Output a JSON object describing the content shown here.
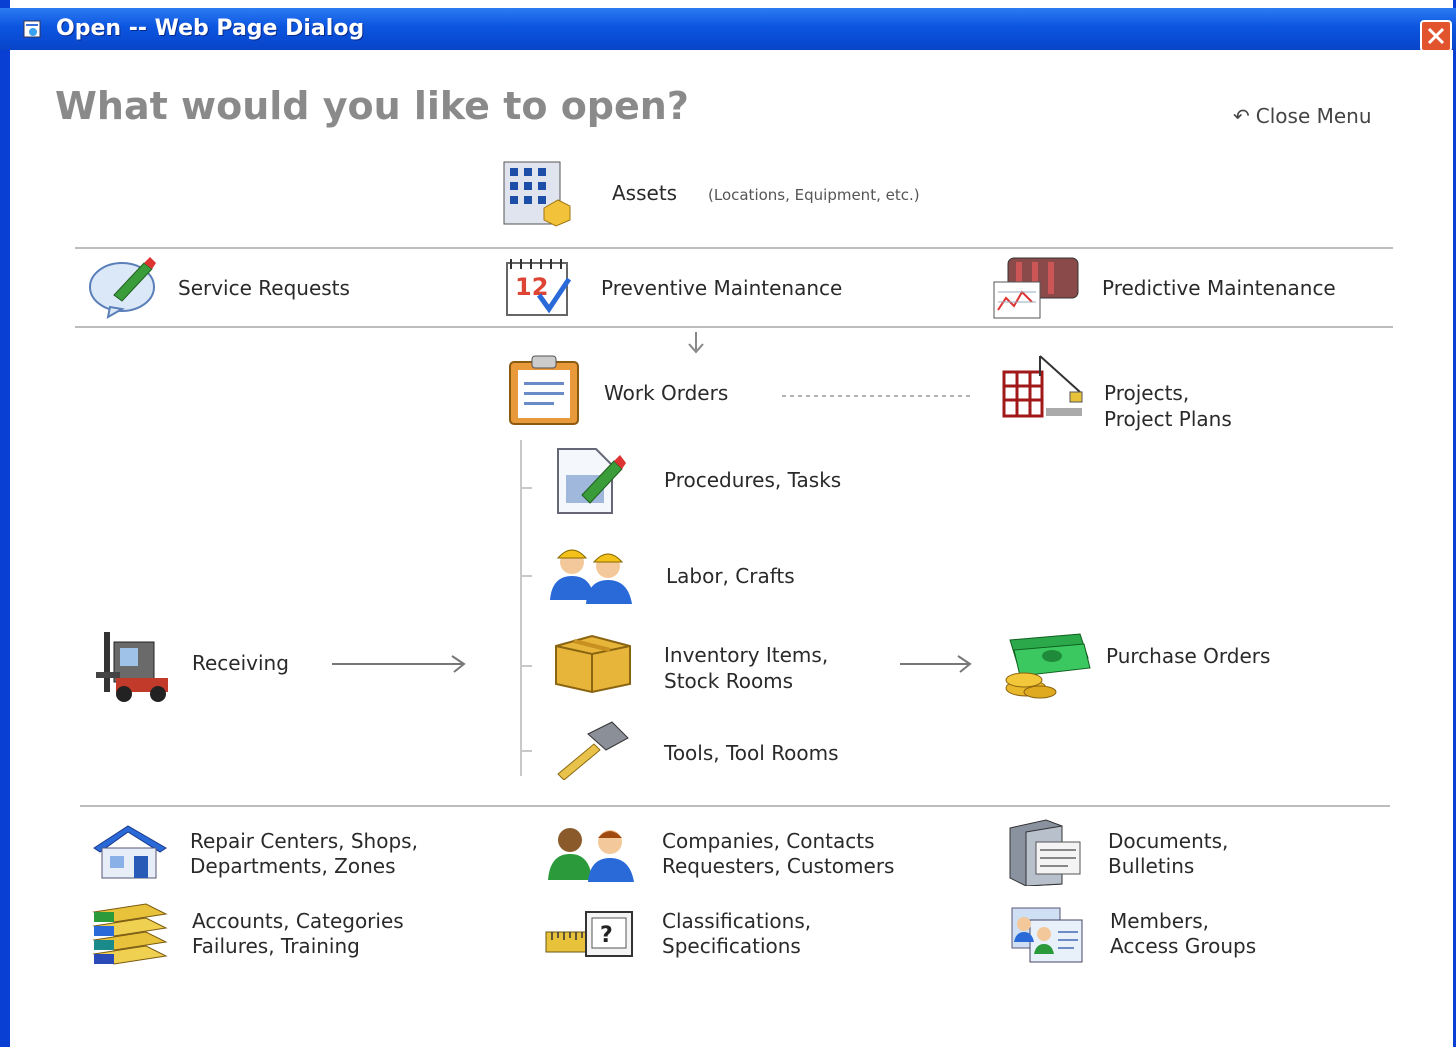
{
  "window": {
    "title": "Open -- Web Page Dialog"
  },
  "heading": "What would you like to open?",
  "close_menu": {
    "arrow": "↶",
    "label": "Close Menu"
  },
  "assets": {
    "label": "Assets",
    "sub": "(Locations, Equipment, etc.)"
  },
  "row1": {
    "service_requests": "Service Requests",
    "preventive_maintenance": "Preventive Maintenance",
    "predictive_maintenance": "Predictive Maintenance"
  },
  "work_orders": "Work Orders",
  "projects": {
    "line1": "Projects,",
    "line2": "Project Plans"
  },
  "procedures": "Procedures, Tasks",
  "labor": "Labor, Crafts",
  "receiving": "Receiving",
  "inventory": {
    "line1": "Inventory Items,",
    "line2": "Stock Rooms"
  },
  "purchase_orders": "Purchase Orders",
  "tools": "Tools, Tool Rooms",
  "bottom": {
    "repair": {
      "line1": "Repair Centers, Shops,",
      "line2": "Departments, Zones"
    },
    "companies": {
      "line1": "Companies, Contacts",
      "line2": "Requesters, Customers"
    },
    "documents": {
      "line1": "Documents,",
      "line2": "Bulletins"
    },
    "accounts": {
      "line1": "Accounts, Categories",
      "line2": "Failures, Training"
    },
    "classifications": {
      "line1": "Classifications,",
      "line2": "Specifications"
    },
    "members": {
      "line1": "Members,",
      "line2": "Access Groups"
    }
  },
  "colors": {
    "titlebar": "#0c55e0",
    "frame": "#0a3fd4",
    "close": "#e2542d",
    "heading": "#8a8a8a"
  }
}
